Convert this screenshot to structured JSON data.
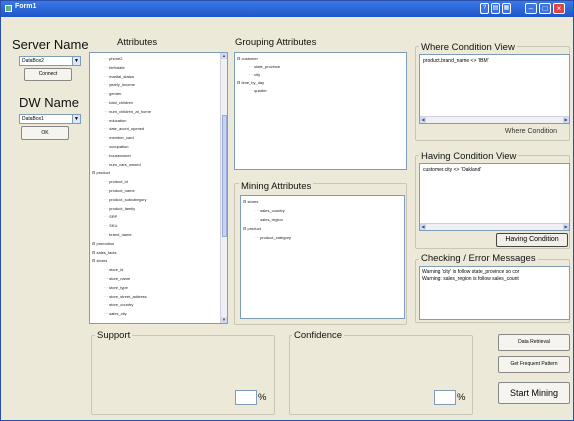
{
  "window": {
    "title": "Form1"
  },
  "server": {
    "label": "Server Name",
    "combo_value": "DataBox2",
    "connect_label": "Connect"
  },
  "dw": {
    "label": "DW Name",
    "combo_value": "DataBox1",
    "ok_label": "OK"
  },
  "attributes": {
    "label": "Attributes",
    "items": [
      {
        "text": "phone2",
        "indent": 2
      },
      {
        "text": "birthdate",
        "indent": 2
      },
      {
        "text": "marital_status",
        "indent": 2
      },
      {
        "text": "yearly_income",
        "indent": 2
      },
      {
        "text": "gender",
        "indent": 2
      },
      {
        "text": "total_children",
        "indent": 2
      },
      {
        "text": "num_children_at_home",
        "indent": 2
      },
      {
        "text": "education",
        "indent": 2
      },
      {
        "text": "date_accnt_opened",
        "indent": 2
      },
      {
        "text": "member_card",
        "indent": 2
      },
      {
        "text": "occupation",
        "indent": 2
      },
      {
        "text": "houseowner",
        "indent": 2
      },
      {
        "text": "num_cars_owned",
        "indent": 2
      },
      {
        "text": "product",
        "indent": 0
      },
      {
        "text": "product_id",
        "indent": 2
      },
      {
        "text": "product_name",
        "indent": 2
      },
      {
        "text": "product_subcategory",
        "indent": 2
      },
      {
        "text": "product_family",
        "indent": 2
      },
      {
        "text": "SRP",
        "indent": 2
      },
      {
        "text": "SKU",
        "indent": 2
      },
      {
        "text": "brand_name",
        "indent": 2
      },
      {
        "text": "promotion",
        "indent": 0
      },
      {
        "text": "sales_facts",
        "indent": 0
      },
      {
        "text": "stores",
        "indent": 0
      },
      {
        "text": "store_id",
        "indent": 2
      },
      {
        "text": "store_name",
        "indent": 2
      },
      {
        "text": "store_type",
        "indent": 2
      },
      {
        "text": "store_street_address",
        "indent": 2
      },
      {
        "text": "store_country",
        "indent": 2
      },
      {
        "text": "sales_city",
        "indent": 2
      }
    ]
  },
  "grouping": {
    "label": "Grouping Attributes",
    "items": [
      {
        "text": "customer",
        "indent": 0
      },
      {
        "text": "state_province",
        "indent": 2
      },
      {
        "text": "city",
        "indent": 2
      },
      {
        "text": "time_by_day",
        "indent": 0
      },
      {
        "text": "quarter",
        "indent": 2
      }
    ]
  },
  "mining": {
    "label": "Mining Attributes",
    "items": [
      {
        "text": "stores",
        "indent": 0
      },
      {
        "text": "sales_country",
        "indent": 2
      },
      {
        "text": "sales_region",
        "indent": 2
      },
      {
        "text": "product",
        "indent": 0
      },
      {
        "text": "product_category",
        "indent": 2
      }
    ]
  },
  "where": {
    "label": "Where Condition View",
    "text": "product.brand_name <> 'IBM'",
    "button": "Where Condition"
  },
  "having": {
    "label": "Having Condition View",
    "text": "customer.city <> 'Oakland'",
    "button": "Having Condition"
  },
  "messages": {
    "label": "Checking / Error Messages",
    "lines": [
      "Warning 'city' is follow state_province so cor",
      "Warning: sales_region is follow sales_count"
    ]
  },
  "support": {
    "label": "Support",
    "pct": "%"
  },
  "confidence": {
    "label": "Confidence",
    "pct": "%"
  },
  "actions": {
    "data_retrieval": "Data Retrieval",
    "get_frequent": "Get Frequent Pattern",
    "start_mining": "Start Mining"
  }
}
